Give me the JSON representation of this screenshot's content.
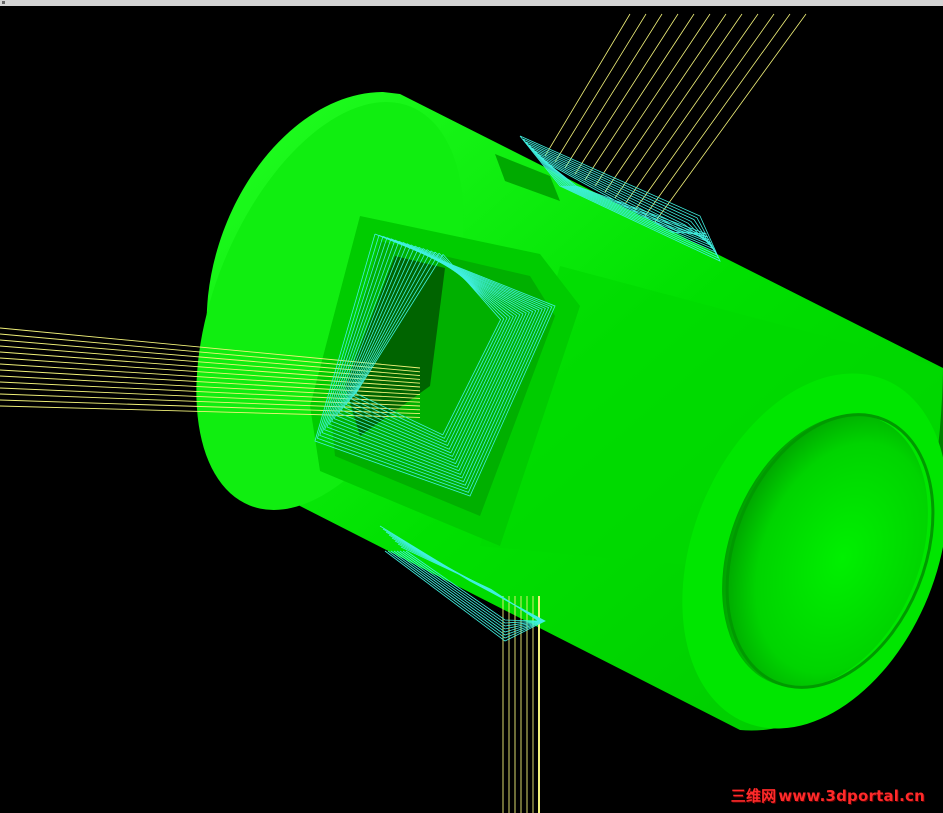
{
  "viewport": {
    "background": "#000000",
    "title_strip_color": "#d4d4d4"
  },
  "model": {
    "body_color": "#00e600",
    "shade_color": "#00b300",
    "highlight_color": "#33ff33",
    "toolpath_in_color": "#f2f27a",
    "toolpath_cut_color": "#40f0e0"
  },
  "watermark": {
    "cn": "三维网",
    "url": "www.3dportal.cn",
    "color": "#ff2a2a"
  }
}
